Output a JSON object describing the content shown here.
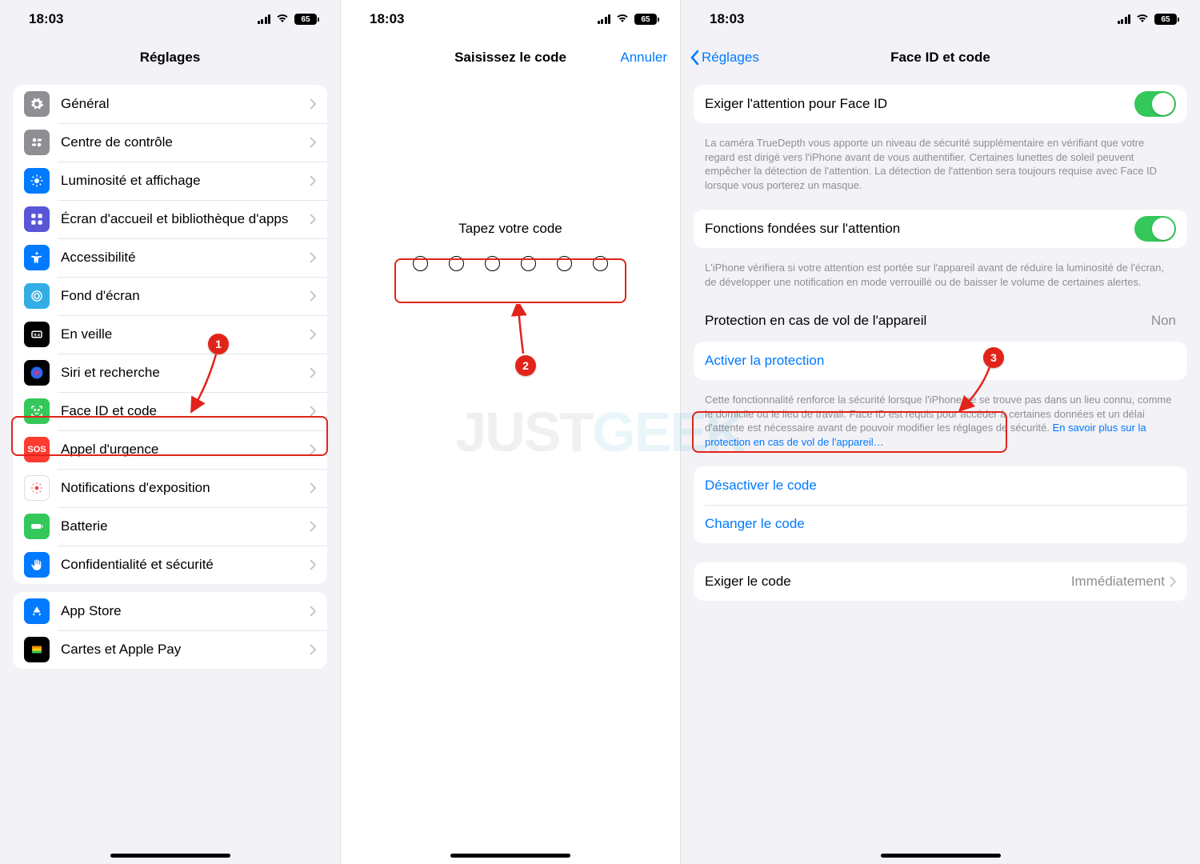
{
  "status": {
    "time": "18:03",
    "battery": "65"
  },
  "p1": {
    "title": "Réglages",
    "items": [
      "Général",
      "Centre de contrôle",
      "Luminosité et affichage",
      "Écran d'accueil et bibliothèque d'apps",
      "Accessibilité",
      "Fond d'écran",
      "En veille",
      "Siri et recherche",
      "Face ID et code",
      "Appel d'urgence",
      "Notifications d'exposition",
      "Batterie",
      "Confidentialité et sécurité"
    ],
    "items2": [
      "App Store",
      "Cartes et Apple Pay"
    ]
  },
  "p2": {
    "title": "Saisissez le code",
    "cancel": "Annuler",
    "prompt": "Tapez votre code"
  },
  "p3": {
    "back": "Réglages",
    "title": "Face ID et code",
    "row_attention": "Exiger l'attention pour Face ID",
    "foot_attention": "La caméra TrueDepth vous apporte un niveau de sécurité supplémentaire en vérifiant que votre regard est dirigé vers l'iPhone avant de vous authentifier. Certaines lunettes de soleil peuvent empêcher la détection de l'attention. La détection de l'attention sera toujours requise avec Face ID lorsque vous porterez un masque.",
    "row_features": "Fonctions fondées sur l'attention",
    "foot_features": "L'iPhone vérifiera si votre attention est portée sur l'appareil avant de réduire la luminosité de l'écran, de développer une notification en mode verrouillé ou de baisser le volume de certaines alertes.",
    "theft_header": "Protection en cas de vol de l'appareil",
    "theft_value": "Non",
    "theft_action": "Activer la protection",
    "theft_foot": "Cette fonctionnalité renforce la sécurité lorsque l'iPhone ne se trouve pas dans un lieu connu, comme le domicile ou le lieu de travail. Face ID est requis pour accéder à certaines données et un délai d'attente est nécessaire avant de pouvoir modifier les réglages de sécurité. ",
    "theft_link": "En savoir plus sur la protection en cas de vol de l'appareil…",
    "disable_code": "Désactiver le code",
    "change_code": "Changer le code",
    "require_label": "Exiger le code",
    "require_value": "Immédiatement"
  },
  "callouts": {
    "b1": "1",
    "b2": "2",
    "b3": "3"
  },
  "watermark": {
    "a": "JUST",
    "b": "GEEK"
  }
}
